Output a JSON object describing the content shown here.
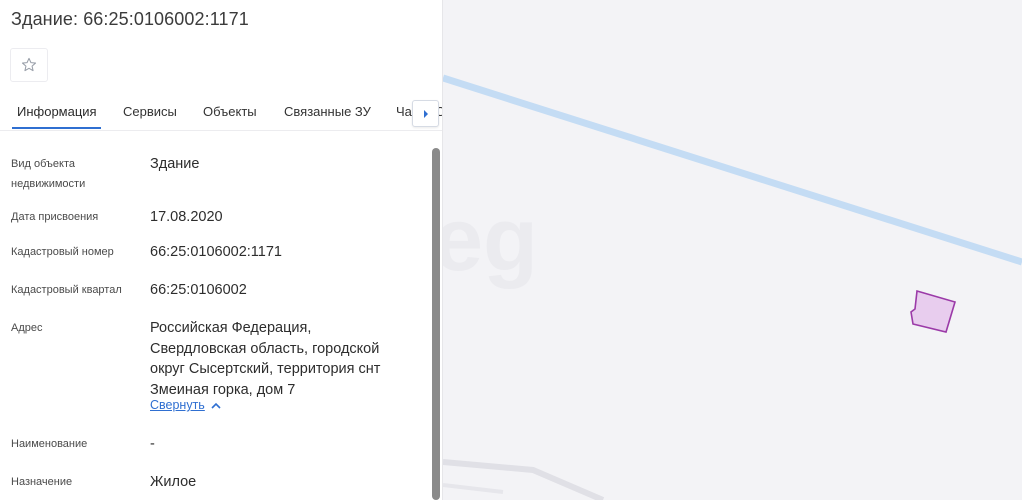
{
  "header": {
    "title": "Здание: 66:25:0106002:1171",
    "favorite_icon": "star-outline-icon"
  },
  "tabs": [
    {
      "label": "Информация",
      "active": true
    },
    {
      "label": "Сервисы",
      "active": false
    },
    {
      "label": "Объекты",
      "active": false
    },
    {
      "label": "Связанные ЗУ",
      "active": false
    },
    {
      "label": "Части О",
      "active": false
    }
  ],
  "tab_scroll_icon": "chevron-right-icon",
  "info": {
    "object_type": {
      "label": "Вид объекта недвижимости",
      "value": "Здание"
    },
    "assigned_date": {
      "label": "Дата присвоения",
      "value": "17.08.2020"
    },
    "cadastral_number": {
      "label": "Кадастровый номер",
      "value": "66:25:0106002:1171"
    },
    "cadastral_quarter": {
      "label": "Кадастровый квартал",
      "value": "66:25:0106002"
    },
    "address": {
      "label": "Адрес",
      "value": "Российская Федерация, Свердловская область, городской округ Сысертский, территория снт Змеиная горка, дом 7",
      "collapse_label": "Свернуть"
    },
    "name": {
      "label": "Наименование",
      "value": "-"
    },
    "purpose": {
      "label": "Назначение",
      "value": "Жилое"
    }
  },
  "colors": {
    "accent": "#2f6fd1",
    "road": "#bfd8f3",
    "parcel_fill": "#e8cdee",
    "parcel_stroke": "#9b3aa8"
  }
}
